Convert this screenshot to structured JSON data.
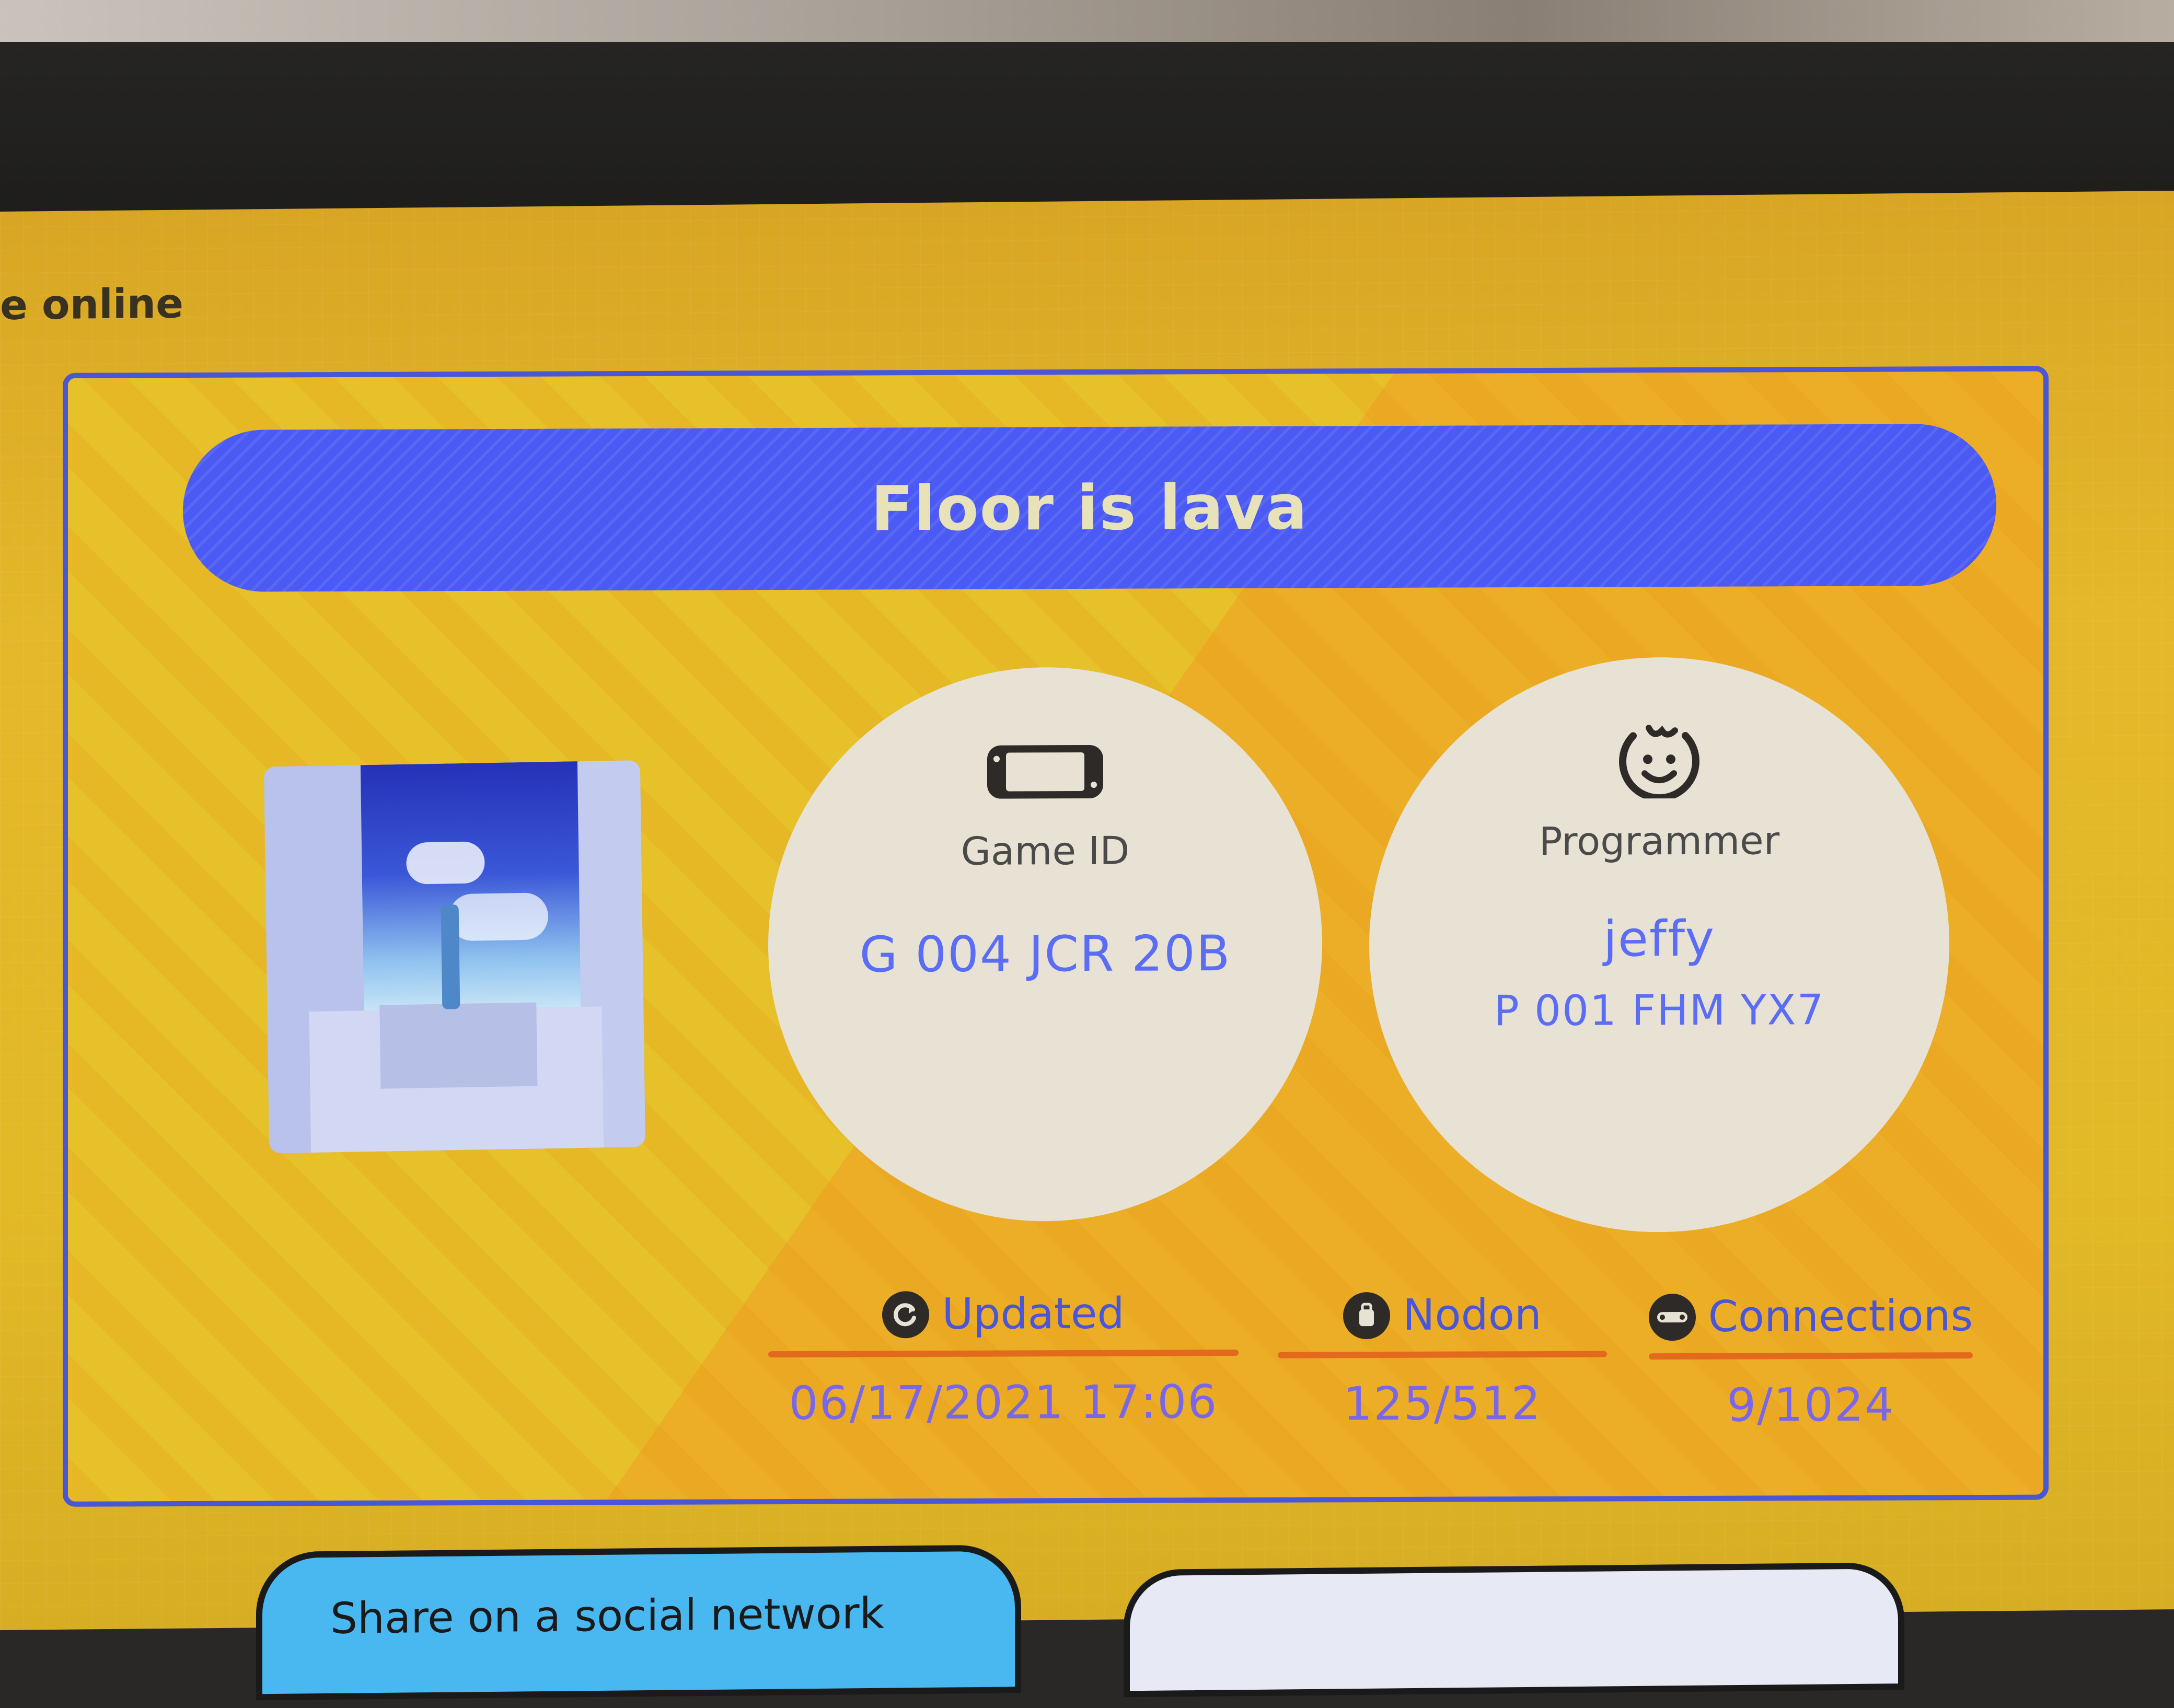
{
  "header": {
    "online_label": "e online"
  },
  "game": {
    "title": "Floor is lava",
    "thumbnail_icon": "game-thumbnail",
    "game_id_label": "Game ID",
    "game_id": "G 004 JCR 20B",
    "game_id_icon": "game-console-icon",
    "programmer_label": "Programmer",
    "programmer_name": "jeffy",
    "programmer_id": "P 001 FHM YX7",
    "programmer_icon": "smiley-face-icon"
  },
  "stats": {
    "updated_label": "Updated",
    "updated_value": "06/17/2021 17:06",
    "updated_icon": "refresh-icon",
    "nodon_label": "Nodon",
    "nodon_value": "125/512",
    "nodon_icon": "nodon-icon",
    "connections_label": "Connections",
    "connections_value": "9/1024",
    "connections_icon": "connection-icon"
  },
  "buttons": {
    "share_label": "Share on a social network"
  },
  "colors": {
    "background": "#e2b927",
    "accent_blue": "#4b5af4",
    "value_blue": "#5b6cf5",
    "underline_orange": "#e36a1d",
    "circle_fill": "#e7e2d4"
  }
}
